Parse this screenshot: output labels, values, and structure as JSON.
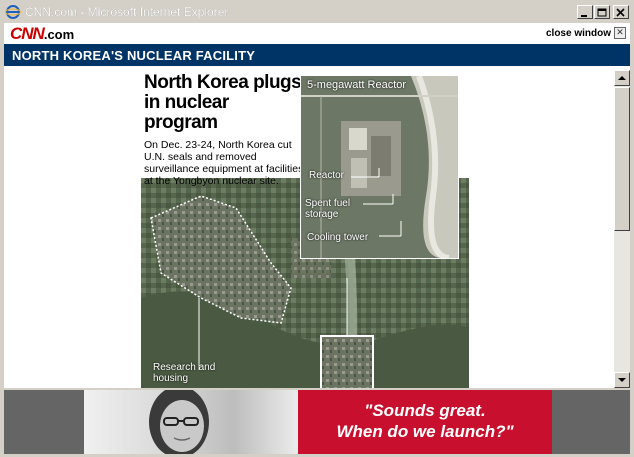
{
  "window": {
    "title_site": "CNN.com",
    "title_app": " - Microsoft Internet Explorer"
  },
  "cnn": {
    "logo_main": "CNN",
    "logo_suffix": ".com",
    "close_window_label": "close window"
  },
  "header": {
    "title": "NORTH KOREA'S NUCLEAR FACILITY"
  },
  "story": {
    "headline_line1": "North Korea plugs",
    "headline_line2": "in nuclear program",
    "deck": "On Dec. 23-24, North Korea cut U.N. seals and removed surveillance equipment at facilities at the Yongbyon nuclear site."
  },
  "map": {
    "inset_title": "5-megawatt Reactor",
    "label_reactor": "Reactor",
    "label_spent_fuel_1": "Spent fuel",
    "label_spent_fuel_2": "storage",
    "label_cooling_tower": "Cooling tower",
    "label_research_1": "Research and",
    "label_research_2": "housing"
  },
  "ad": {
    "quote_line1": "\"Sounds great.",
    "quote_line2": "When do we launch?\""
  },
  "colors": {
    "header_bg": "#003366",
    "cnn_red": "#cc0000",
    "ad_red": "#c8102e"
  }
}
